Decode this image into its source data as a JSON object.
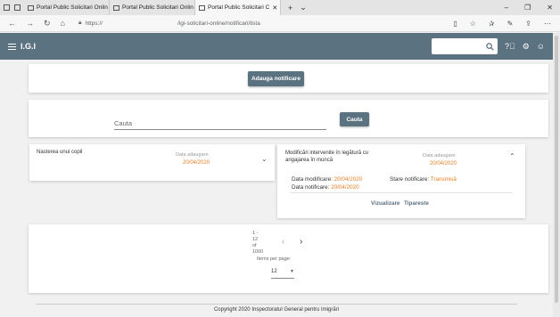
{
  "browser": {
    "tabs": [
      {
        "title": "Portal Public Solicitari Onlin"
      },
      {
        "title": "Portal Public Solicitari Onlin"
      },
      {
        "title": "Portal Public Solicitari C"
      }
    ],
    "url_prefix": "https://",
    "url_path": "/igi-solicitari-online/notificari/lista"
  },
  "appbar": {
    "brand": "I.G.I"
  },
  "actions": {
    "add_label": "Adauga notificare"
  },
  "search": {
    "placeholder": "Cauta",
    "button_label": "Cauta"
  },
  "notifications": [
    {
      "title": "Nasterea unui copil",
      "date_label": "Data adaugare:",
      "date_value": "20/04/2020",
      "expanded": false
    },
    {
      "title": "Modificări intervenite în legătură cu angajarea în muncă",
      "date_label": "Data adaugare:",
      "date_value": "20/04/2020",
      "expanded": true,
      "details": {
        "modified_label": "Data modificare:",
        "modified_value": "20/04/2020",
        "status_label": "Stare notificare:",
        "status_value": "Transmisă",
        "notified_label": "Data notificare:",
        "notified_value": "20/04/2020"
      },
      "actions": {
        "view_label": "Vizualizare",
        "print_label": "Tipareste"
      }
    }
  ],
  "pagination": {
    "range_line1": "1 -",
    "range_line2": "12",
    "range_line3": "of",
    "range_line4": "1000",
    "items_per_page_label": "Items per page:",
    "items_per_page_value": "12"
  },
  "footer": {
    "text": "Copyright 2020 Inspectoratul General pentru Imigrări"
  },
  "colors": {
    "primary": "#5b7281",
    "accent": "#e67e22"
  }
}
